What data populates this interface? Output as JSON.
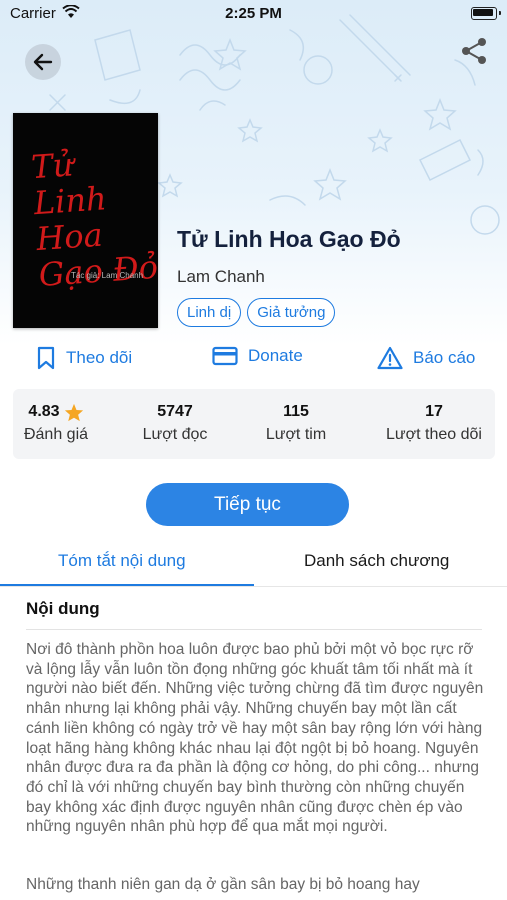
{
  "status_bar": {
    "carrier": "Carrier",
    "time": "2:25 PM"
  },
  "book": {
    "cover_title": "Tử Linh Hoa Gạo Đỏ",
    "cover_author": "Tác giả: Lam Chanh",
    "title": "Tử Linh Hoa Gạo Đỏ",
    "author": "Lam Chanh",
    "tags": [
      "Linh dị",
      "Giả tưởng"
    ]
  },
  "actions": {
    "follow": "Theo dõi",
    "donate": "Donate",
    "report": "Báo cáo"
  },
  "stats": [
    {
      "value": "4.83",
      "label": "Đánh giá"
    },
    {
      "value": "5747",
      "label": "Lượt đọc"
    },
    {
      "value": "115",
      "label": "Lượt tim"
    },
    {
      "value": "17",
      "label": "Lượt theo dõi"
    }
  ],
  "continue_label": "Tiếp tục",
  "tabs": {
    "summary": "Tóm tắt nội dung",
    "chapters": "Danh sách chương"
  },
  "content": {
    "heading": "Nội dung",
    "paragraphs": [
      "Nơi đô thành phồn hoa luôn được bao phủ bởi một vỏ bọc rực rỡ và lộng lẫy vẫn luôn tồn đọng những góc khuất tâm tối nhất mà ít người nào biết đến. Những việc tưởng chừng đã tìm được nguyên nhân nhưng lại không phải vậy. Những chuyến bay một lần cất cánh liền không có ngày trở về hay một sân bay rộng lớn với hàng loạt hãng hàng không khác nhau lại đột ngột bị bỏ hoang. Nguyên nhân được đưa ra đa phần là động cơ hỏng, do phi công... nhưng đó chỉ là với những chuyến bay bình thường còn những chuyến bay không xác định được nguyên nhân cũng được chèn ép vào những nguyên nhân phù hợp để qua mắt mọi người.",
      "Những thanh niên gan dạ ở gần sân bay bị bỏ hoang hay"
    ]
  },
  "colors": {
    "accent": "#1e7be0",
    "button": "#2c84e4",
    "cover_text": "#d11a1a",
    "star": "#f5a623"
  },
  "icons": [
    "back-arrow-icon",
    "share-icon",
    "bookmark-icon",
    "card-icon",
    "warning-icon",
    "star-icon",
    "wifi-icon",
    "battery-icon"
  ]
}
